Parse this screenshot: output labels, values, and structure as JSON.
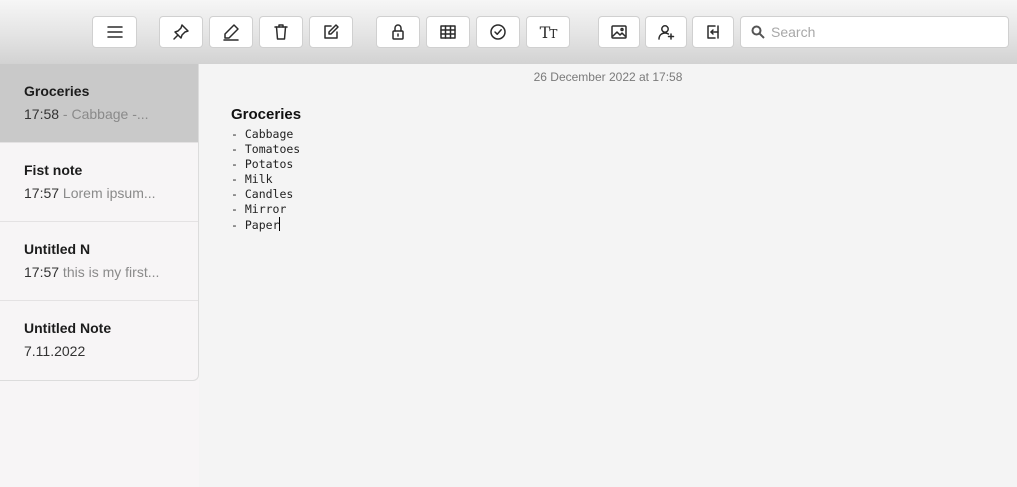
{
  "toolbar": {
    "buttons": [
      {
        "name": "menu-button",
        "icon": "menu-icon"
      },
      {
        "name": "pin-button",
        "icon": "pin-icon"
      },
      {
        "name": "pen-button",
        "icon": "pen-icon"
      },
      {
        "name": "delete-button",
        "icon": "trash-icon"
      },
      {
        "name": "new-note-button",
        "icon": "compose-icon"
      },
      {
        "name": "lock-button",
        "icon": "lock-icon"
      },
      {
        "name": "table-button",
        "icon": "table-icon"
      },
      {
        "name": "checklist-button",
        "icon": "check-circle-icon"
      },
      {
        "name": "format-button",
        "icon": "text-format-icon"
      },
      {
        "name": "image-button",
        "icon": "image-icon"
      },
      {
        "name": "share-button",
        "icon": "add-person-icon"
      },
      {
        "name": "export-button",
        "icon": "export-icon"
      }
    ],
    "search": {
      "placeholder": "Search",
      "value": ""
    }
  },
  "sidebar": {
    "notes": [
      {
        "title": "Groceries",
        "time": "17:58",
        "preview": " - Cabbage -...",
        "selected": true
      },
      {
        "title": "Fist note",
        "time": "17:57",
        "preview": " Lorem ipsum...",
        "selected": false
      },
      {
        "title": "Untitled N",
        "time": "17:57",
        "preview": " this is my first...",
        "selected": false
      },
      {
        "title": "Untitled Note",
        "time": "7.11.2022",
        "preview": "",
        "selected": false
      }
    ]
  },
  "editor": {
    "date": "26 December 2022 at 17:58",
    "title": "Groceries",
    "lines": [
      "- Cabbage",
      "- Tomatoes",
      "- Potatos",
      "- Milk",
      "- Candles",
      "- Mirror",
      "- Paper"
    ]
  },
  "colors": {
    "selected_note_bg": "#c9c9c9",
    "preview_text": "#8a8a8a",
    "date_text": "#7a7a7a"
  }
}
